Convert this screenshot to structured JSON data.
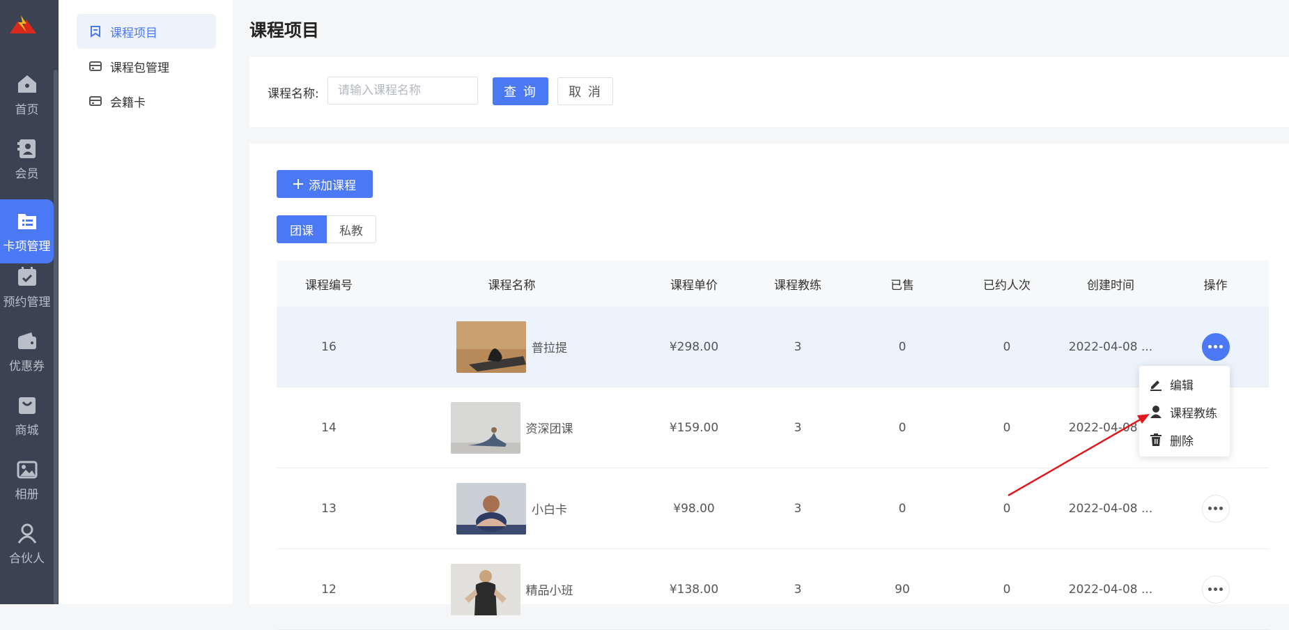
{
  "rail": {
    "items": [
      {
        "label": "首页",
        "icon": "home-icon"
      },
      {
        "label": "会员",
        "icon": "member-icon"
      },
      {
        "label": "卡项管理",
        "icon": "card-list-icon"
      },
      {
        "label": "预约管理",
        "icon": "calendar-check-icon"
      },
      {
        "label": "优惠券",
        "icon": "wallet-icon"
      },
      {
        "label": "商城",
        "icon": "shop-bag-icon"
      },
      {
        "label": "相册",
        "icon": "album-icon"
      },
      {
        "label": "合伙人",
        "icon": "partner-icon"
      }
    ]
  },
  "sidebar": {
    "items": [
      {
        "label": "课程项目"
      },
      {
        "label": "课程包管理"
      },
      {
        "label": "会籍卡"
      }
    ]
  },
  "page": {
    "title": "课程项目"
  },
  "filter": {
    "label": "课程名称:",
    "placeholder": "请输入课程名称",
    "query_label": "查 询",
    "cancel_label": "取 消"
  },
  "list": {
    "add_label": "添加课程",
    "tabs": [
      {
        "label": "团课"
      },
      {
        "label": "私教"
      }
    ],
    "headers": [
      "课程编号",
      "课程名称",
      "课程单价",
      "课程教练",
      "已售",
      "已约人次",
      "创建时间",
      "操作"
    ],
    "rows": [
      {
        "id": "16",
        "name": "普拉提",
        "price": "¥298.00",
        "coach": "3",
        "sold": "0",
        "booked": "0",
        "created": "2022-04-08 ..."
      },
      {
        "id": "14",
        "name": "资深团课",
        "price": "¥159.00",
        "coach": "3",
        "sold": "0",
        "booked": "0",
        "created": "2022-04-08 ..."
      },
      {
        "id": "13",
        "name": "小白卡",
        "price": "¥98.00",
        "coach": "3",
        "sold": "0",
        "booked": "0",
        "created": "2022-04-08 ..."
      },
      {
        "id": "12",
        "name": "精品小班",
        "price": "¥138.00",
        "coach": "3",
        "sold": "90",
        "booked": "0",
        "created": "2022-04-08 ..."
      }
    ]
  },
  "menu": {
    "items": [
      {
        "label": "编辑",
        "icon": "edit-icon"
      },
      {
        "label": "课程教练",
        "icon": "person-icon"
      },
      {
        "label": "删除",
        "icon": "trash-icon"
      }
    ]
  },
  "colors": {
    "primary": "#4b78f5",
    "rail_bg": "#3b4352",
    "arrow": "#e0191e"
  }
}
